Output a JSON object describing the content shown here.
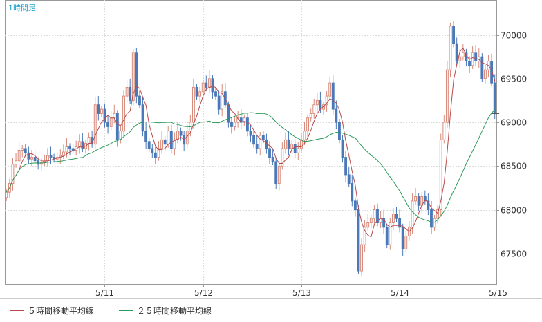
{
  "chart_data": {
    "type": "candlestick",
    "timeframe_label": "1時間足",
    "y_ticks": [
      70000,
      69500,
      69000,
      68500,
      68000,
      67500
    ],
    "ylim": [
      67150,
      70400
    ],
    "x_tick_labels": [
      {
        "label": "5/11",
        "bar": 31
      },
      {
        "label": "5/12",
        "bar": 62
      },
      {
        "label": "5/13",
        "bar": 93
      },
      {
        "label": "5/14",
        "bar": 124
      },
      {
        "label": "5/15",
        "bar": 155
      }
    ],
    "up_color": "#d88a7a",
    "down_color": "#4a78b8",
    "ma_lines": [
      {
        "name": "５時間移動平均線",
        "color": "#b84a4a",
        "period": 5
      },
      {
        "name": "２５時間移動平均線",
        "color": "#2a9a5a",
        "period": 25
      }
    ],
    "closes": [
      68200,
      68300,
      68520,
      68560,
      68680,
      68700,
      68650,
      68580,
      68600,
      68560,
      68520,
      68540,
      68560,
      68620,
      68600,
      68580,
      68600,
      68620,
      68660,
      68720,
      68700,
      68680,
      68720,
      68780,
      68700,
      68760,
      68830,
      68750,
      69200,
      69100,
      69150,
      69000,
      68950,
      69050,
      69100,
      68800,
      68900,
      69300,
      69400,
      69250,
      69800,
      69300,
      69200,
      68900,
      68780,
      68700,
      68650,
      68600,
      68700,
      68800,
      68750,
      68900,
      68700,
      68800,
      68900,
      68850,
      68750,
      68900,
      69000,
      69400,
      69300,
      69350,
      69450,
      69400,
      69500,
      69350,
      69300,
      69150,
      69350,
      69200,
      69000,
      68950,
      69000,
      69050,
      69000,
      69050,
      68900,
      68850,
      68750,
      68700,
      68850,
      68800,
      68700,
      68600,
      68550,
      68300,
      68500,
      68700,
      68800,
      68700,
      68750,
      68650,
      68700,
      68800,
      68900,
      69050,
      69100,
      69200,
      69250,
      69150,
      69200,
      69300,
      69450,
      69150,
      69000,
      68800,
      68600,
      68400,
      68300,
      68100,
      68000,
      67300,
      67600,
      67800,
      67850,
      67900,
      68000,
      67850,
      67900,
      67800,
      67600,
      67850,
      67950,
      67900,
      67800,
      67550,
      67700,
      67800,
      68100,
      68150,
      68050,
      68150,
      68100,
      68000,
      67800,
      67900,
      68000,
      68800,
      69000,
      69600,
      70100,
      69900,
      69700,
      69750,
      69800,
      69700,
      69650,
      69800,
      69700,
      69750,
      69500,
      69600,
      69700,
      69450,
      69100
    ]
  },
  "legend": {
    "ma5": "５時間移動平均線",
    "ma25": "２５時間移動平均線"
  }
}
